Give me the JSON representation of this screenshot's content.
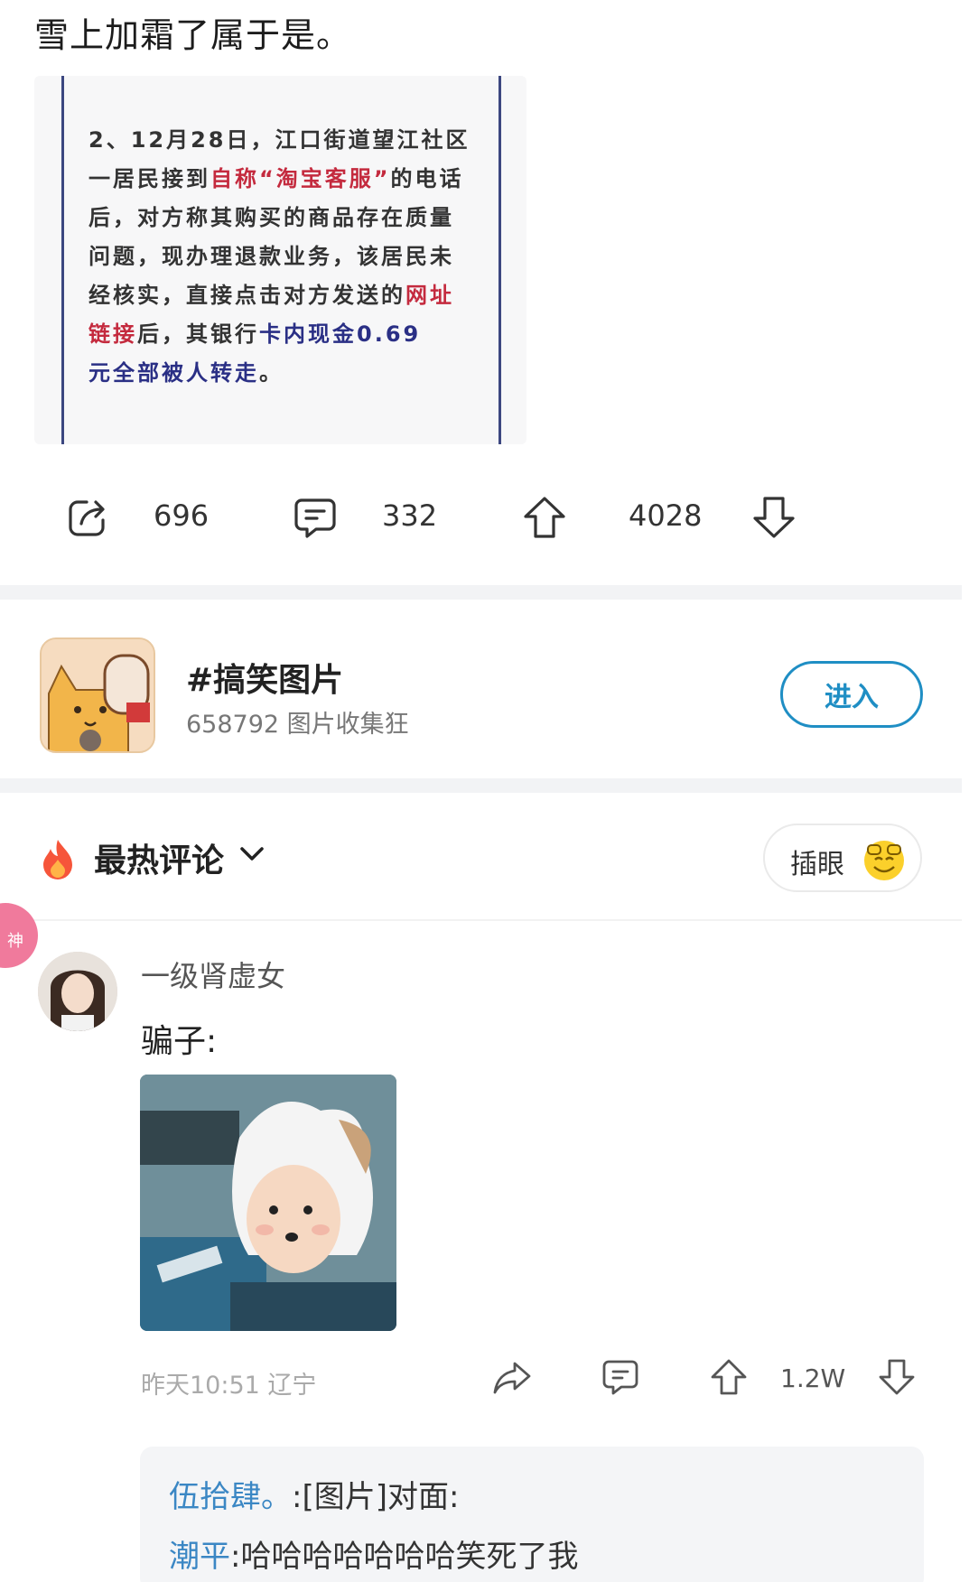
{
  "post": {
    "text": "雪上加霜了属于是。"
  },
  "news_image": {
    "lines": [
      [
        {
          "t": "2、12月28日，江口街道望江社区",
          "c": ""
        }
      ],
      [
        {
          "t": "一居民接到",
          "c": ""
        },
        {
          "t": "自称“淘宝客服”",
          "c": "red"
        },
        {
          "t": "的电话",
          "c": ""
        }
      ],
      [
        {
          "t": "后，对方称其购买的商品存在质量",
          "c": ""
        }
      ],
      [
        {
          "t": "问题，现办理退款业务，该居民未",
          "c": ""
        }
      ],
      [
        {
          "t": "经核实，直接点击对方发送的",
          "c": ""
        },
        {
          "t": "网址",
          "c": "red"
        }
      ],
      [
        {
          "t": "链接",
          "c": "red"
        },
        {
          "t": "后，其银行",
          "c": ""
        },
        {
          "t": "卡内现金0.69",
          "c": "blue"
        }
      ],
      [
        {
          "t": "元全部被人转走",
          "c": "blue"
        },
        {
          "t": "。",
          "c": ""
        }
      ]
    ]
  },
  "actions": {
    "share_count": "696",
    "comment_count": "332",
    "upvote_count": "4028"
  },
  "topic": {
    "title": "#搞笑图片",
    "subtitle": "658792 图片收集狂",
    "enter_label": "进入"
  },
  "comments_header": {
    "title": "最热评论",
    "insert_label": "插眼"
  },
  "comment": {
    "badge": "神",
    "user": "一级肾虚女",
    "text": "骗子:",
    "meta": "昨天10:51 辽宁",
    "upvote_count": "1.2W"
  },
  "replies": [
    {
      "who": "伍拾肆。",
      "text": ":[图片]对面:"
    },
    {
      "who": "潮平",
      "text": ":哈哈哈哈哈哈哈笑死了我"
    }
  ],
  "colors": {
    "accent_blue": "#1f8ec4",
    "news_red": "#c42a3e",
    "news_blue": "#2a2f85",
    "reply_name": "#3b87c4",
    "badge_pink": "#f07a9c"
  }
}
